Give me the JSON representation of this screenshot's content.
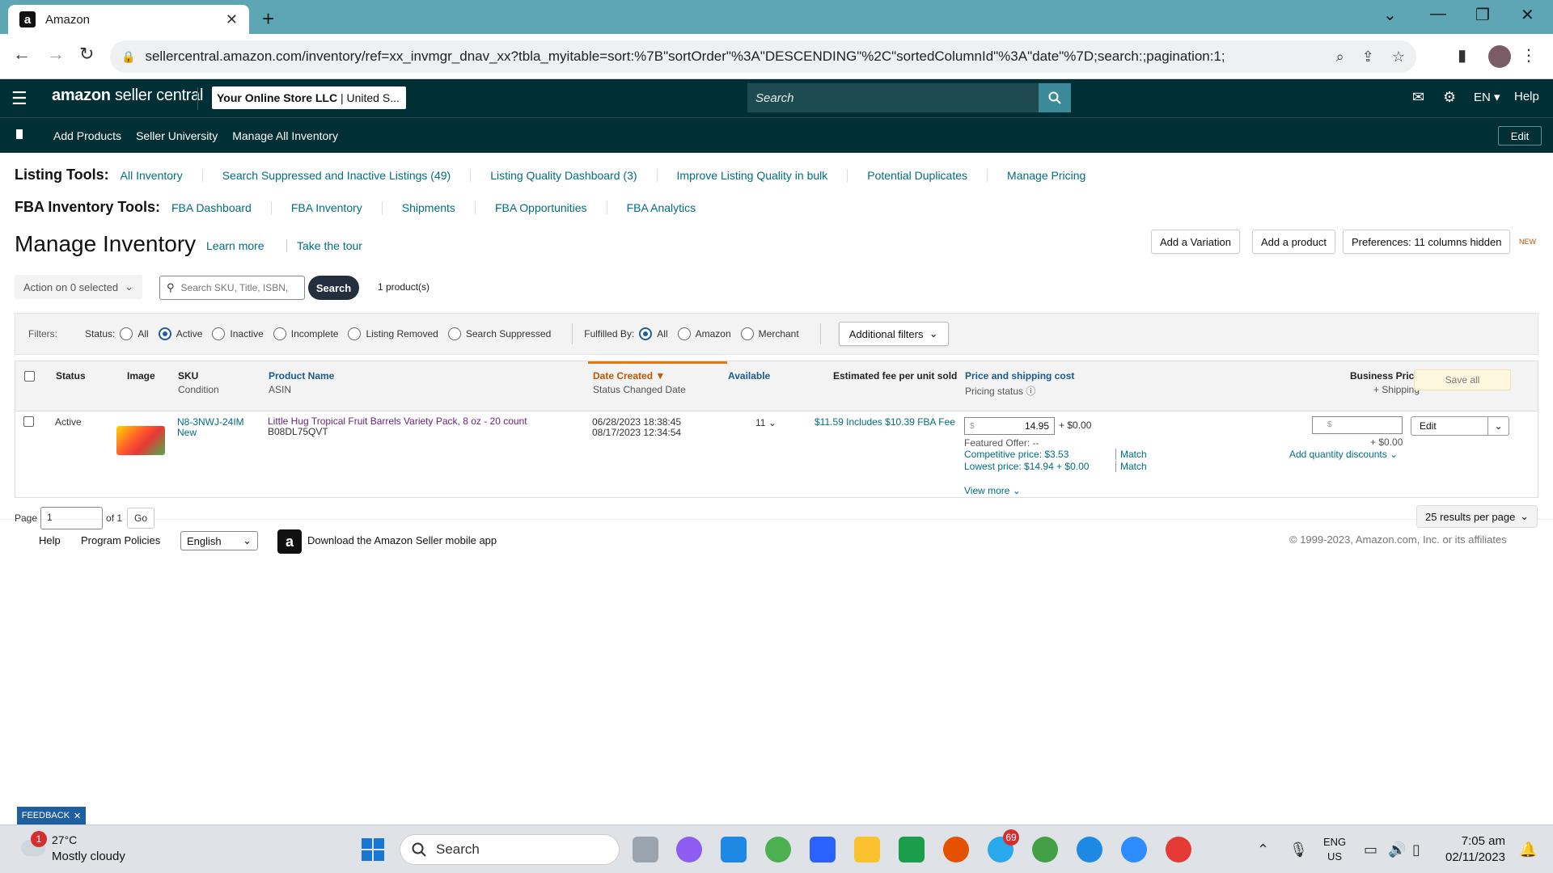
{
  "browser": {
    "tab_title": "Amazon",
    "url": "sellercentral.amazon.com/inventory/ref=xx_invmgr_dnav_xx?tbla_myitable=sort:%7B\"sortOrder\"%3A\"DESCENDING\"%2C\"sortedColumnId\"%3A\"date\"%7D;search:;pagination:1;"
  },
  "header": {
    "brand_prefix": "amazon",
    "brand_suffix": "seller central",
    "store_name": "Your Online Store LLC",
    "store_region": "| United S...",
    "search_placeholder": "Search",
    "lang": "EN",
    "help": "Help"
  },
  "nav": {
    "links": [
      "Add Products",
      "Seller University",
      "Manage All Inventory"
    ],
    "edit": "Edit"
  },
  "listing_tools": {
    "label": "Listing Tools:",
    "links": [
      "All Inventory",
      "Search Suppressed and Inactive Listings (49)",
      "Listing Quality Dashboard (3)",
      "Improve Listing Quality in bulk",
      "Potential Duplicates",
      "Manage Pricing"
    ]
  },
  "fba_tools": {
    "label": "FBA Inventory Tools:",
    "links": [
      "FBA Dashboard",
      "FBA Inventory",
      "Shipments",
      "FBA Opportunities",
      "FBA Analytics"
    ]
  },
  "page": {
    "title": "Manage Inventory",
    "learn_more": "Learn more",
    "take_tour": "Take the tour",
    "add_variation": "Add a Variation",
    "add_product": "Add a product",
    "preferences": "Preferences: 11 columns hidden",
    "new_tag": "NEW",
    "action_select": "Action on 0 selected",
    "search_placeholder": "Search SKU, Title, ISBN,",
    "search_button": "Search",
    "product_count": "1 product(s)"
  },
  "filters": {
    "label": "Filters:",
    "status_label": "Status:",
    "status_options": [
      "All",
      "Active",
      "Inactive",
      "Incomplete",
      "Listing Removed",
      "Search Suppressed"
    ],
    "status_selected": "Active",
    "fulfilled_label": "Fulfilled By:",
    "fulfilled_options": [
      "All",
      "Amazon",
      "Merchant"
    ],
    "fulfilled_selected": "All",
    "additional": "Additional filters"
  },
  "table": {
    "headers": {
      "status": "Status",
      "image": "Image",
      "sku": "SKU",
      "sku_sub": "Condition",
      "name": "Product Name",
      "name_sub": "ASIN",
      "date": "Date Created",
      "date_sub": "Status Changed Date",
      "available": "Available",
      "fee": "Estimated fee per unit sold",
      "price": "Price and shipping cost",
      "price_sub": "Pricing status",
      "business": "Business Price",
      "business_sub": "+ Shipping",
      "save_all": "Save all"
    },
    "row": {
      "status": "Active",
      "sku": "N8-3NWJ-24IM",
      "condition": "New",
      "name": "Little Hug Tropical Fruit Barrels Variety Pack, 8 oz - 20 count",
      "asin": "B08DL75QVT",
      "date_created": "06/28/2023 18:38:45",
      "status_changed": "08/17/2023 12:34:54",
      "available": "11",
      "fee": "$11.59 Includes $10.39 FBA Fee",
      "currency": "$",
      "price": "14.95",
      "shipping": "+ $0.00",
      "featured": "Featured Offer: --",
      "competitive": "Competitive price: $3.53",
      "lowest": "Lowest price: $14.94 + $0.00",
      "match": "Match",
      "view_more": "View more",
      "biz_shipping": "+ $0.00",
      "qty_discounts": "Add quantity discounts",
      "edit": "Edit"
    }
  },
  "pager": {
    "page_label": "Page",
    "page_value": "1",
    "of": "of 1",
    "go": "Go",
    "per_page": "25 results per page"
  },
  "footer": {
    "help": "Help",
    "policies": "Program Policies",
    "language": "English",
    "app": "Download the Amazon Seller mobile app",
    "copyright": "© 1999-2023, Amazon.com, Inc. or its affiliates"
  },
  "feedback": "FEEDBACK",
  "taskbar": {
    "weather_badge": "1",
    "temp": "27°C",
    "condition": "Mostly cloudy",
    "search": "Search",
    "telegram_badge": "69",
    "lang_top": "ENG",
    "lang_bottom": "US",
    "time": "7:05 am",
    "date": "02/11/2023"
  }
}
